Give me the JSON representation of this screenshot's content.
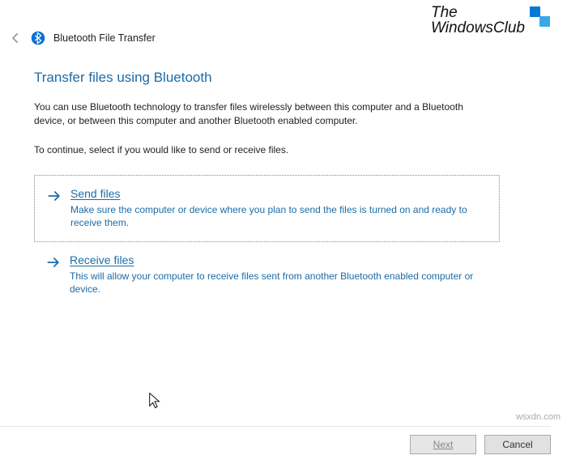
{
  "branding": {
    "line1": "The",
    "line2": "WindowsClub"
  },
  "header": {
    "title": "Bluetooth File Transfer"
  },
  "page": {
    "heading": "Transfer files using Bluetooth",
    "description": "You can use Bluetooth technology to transfer files wirelessly between this computer and a Bluetooth device, or between this computer and another Bluetooth enabled computer.",
    "instruction": "To continue, select if you would like to send or receive files."
  },
  "options": {
    "send": {
      "title": "Send files",
      "desc": "Make sure the computer or device where you plan to send the files is turned on and ready to receive them."
    },
    "receive": {
      "title": "Receive files",
      "desc": "This will allow your computer to receive files sent from another Bluetooth enabled computer or device."
    }
  },
  "buttons": {
    "next": "Next",
    "cancel": "Cancel"
  },
  "attribution": "wsxdn.com",
  "colors": {
    "accent": "#1b6ca8"
  }
}
